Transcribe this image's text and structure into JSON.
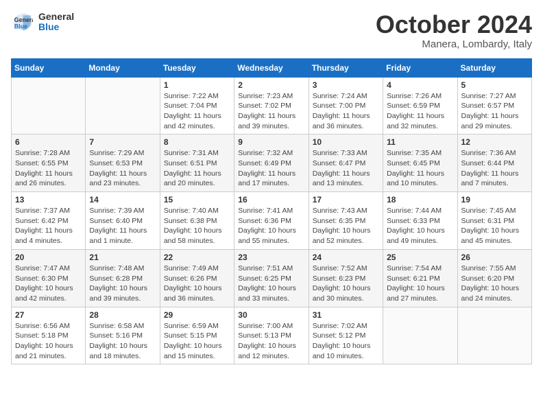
{
  "header": {
    "logo_line1": "General",
    "logo_line2": "Blue",
    "month": "October 2024",
    "location": "Manera, Lombardy, Italy"
  },
  "days_of_week": [
    "Sunday",
    "Monday",
    "Tuesday",
    "Wednesday",
    "Thursday",
    "Friday",
    "Saturday"
  ],
  "weeks": [
    [
      {
        "day": null,
        "info": null
      },
      {
        "day": null,
        "info": null
      },
      {
        "day": "1",
        "info": "Sunrise: 7:22 AM\nSunset: 7:04 PM\nDaylight: 11 hours and 42 minutes."
      },
      {
        "day": "2",
        "info": "Sunrise: 7:23 AM\nSunset: 7:02 PM\nDaylight: 11 hours and 39 minutes."
      },
      {
        "day": "3",
        "info": "Sunrise: 7:24 AM\nSunset: 7:00 PM\nDaylight: 11 hours and 36 minutes."
      },
      {
        "day": "4",
        "info": "Sunrise: 7:26 AM\nSunset: 6:59 PM\nDaylight: 11 hours and 32 minutes."
      },
      {
        "day": "5",
        "info": "Sunrise: 7:27 AM\nSunset: 6:57 PM\nDaylight: 11 hours and 29 minutes."
      }
    ],
    [
      {
        "day": "6",
        "info": "Sunrise: 7:28 AM\nSunset: 6:55 PM\nDaylight: 11 hours and 26 minutes."
      },
      {
        "day": "7",
        "info": "Sunrise: 7:29 AM\nSunset: 6:53 PM\nDaylight: 11 hours and 23 minutes."
      },
      {
        "day": "8",
        "info": "Sunrise: 7:31 AM\nSunset: 6:51 PM\nDaylight: 11 hours and 20 minutes."
      },
      {
        "day": "9",
        "info": "Sunrise: 7:32 AM\nSunset: 6:49 PM\nDaylight: 11 hours and 17 minutes."
      },
      {
        "day": "10",
        "info": "Sunrise: 7:33 AM\nSunset: 6:47 PM\nDaylight: 11 hours and 13 minutes."
      },
      {
        "day": "11",
        "info": "Sunrise: 7:35 AM\nSunset: 6:45 PM\nDaylight: 11 hours and 10 minutes."
      },
      {
        "day": "12",
        "info": "Sunrise: 7:36 AM\nSunset: 6:44 PM\nDaylight: 11 hours and 7 minutes."
      }
    ],
    [
      {
        "day": "13",
        "info": "Sunrise: 7:37 AM\nSunset: 6:42 PM\nDaylight: 11 hours and 4 minutes."
      },
      {
        "day": "14",
        "info": "Sunrise: 7:39 AM\nSunset: 6:40 PM\nDaylight: 11 hours and 1 minute."
      },
      {
        "day": "15",
        "info": "Sunrise: 7:40 AM\nSunset: 6:38 PM\nDaylight: 10 hours and 58 minutes."
      },
      {
        "day": "16",
        "info": "Sunrise: 7:41 AM\nSunset: 6:36 PM\nDaylight: 10 hours and 55 minutes."
      },
      {
        "day": "17",
        "info": "Sunrise: 7:43 AM\nSunset: 6:35 PM\nDaylight: 10 hours and 52 minutes."
      },
      {
        "day": "18",
        "info": "Sunrise: 7:44 AM\nSunset: 6:33 PM\nDaylight: 10 hours and 49 minutes."
      },
      {
        "day": "19",
        "info": "Sunrise: 7:45 AM\nSunset: 6:31 PM\nDaylight: 10 hours and 45 minutes."
      }
    ],
    [
      {
        "day": "20",
        "info": "Sunrise: 7:47 AM\nSunset: 6:30 PM\nDaylight: 10 hours and 42 minutes."
      },
      {
        "day": "21",
        "info": "Sunrise: 7:48 AM\nSunset: 6:28 PM\nDaylight: 10 hours and 39 minutes."
      },
      {
        "day": "22",
        "info": "Sunrise: 7:49 AM\nSunset: 6:26 PM\nDaylight: 10 hours and 36 minutes."
      },
      {
        "day": "23",
        "info": "Sunrise: 7:51 AM\nSunset: 6:25 PM\nDaylight: 10 hours and 33 minutes."
      },
      {
        "day": "24",
        "info": "Sunrise: 7:52 AM\nSunset: 6:23 PM\nDaylight: 10 hours and 30 minutes."
      },
      {
        "day": "25",
        "info": "Sunrise: 7:54 AM\nSunset: 6:21 PM\nDaylight: 10 hours and 27 minutes."
      },
      {
        "day": "26",
        "info": "Sunrise: 7:55 AM\nSunset: 6:20 PM\nDaylight: 10 hours and 24 minutes."
      }
    ],
    [
      {
        "day": "27",
        "info": "Sunrise: 6:56 AM\nSunset: 5:18 PM\nDaylight: 10 hours and 21 minutes."
      },
      {
        "day": "28",
        "info": "Sunrise: 6:58 AM\nSunset: 5:16 PM\nDaylight: 10 hours and 18 minutes."
      },
      {
        "day": "29",
        "info": "Sunrise: 6:59 AM\nSunset: 5:15 PM\nDaylight: 10 hours and 15 minutes."
      },
      {
        "day": "30",
        "info": "Sunrise: 7:00 AM\nSunset: 5:13 PM\nDaylight: 10 hours and 12 minutes."
      },
      {
        "day": "31",
        "info": "Sunrise: 7:02 AM\nSunset: 5:12 PM\nDaylight: 10 hours and 10 minutes."
      },
      {
        "day": null,
        "info": null
      },
      {
        "day": null,
        "info": null
      }
    ]
  ]
}
